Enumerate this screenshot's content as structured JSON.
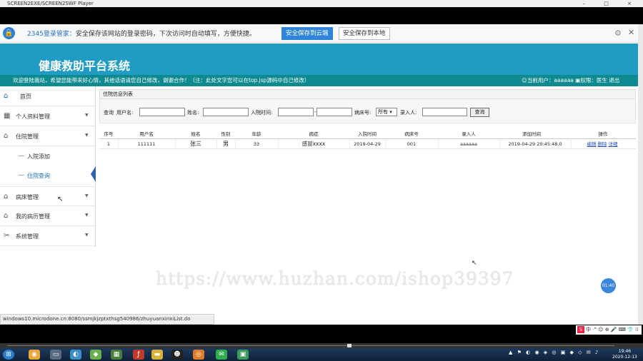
{
  "window": {
    "title": "SCREEN2EXE/SCREEN2SWF Player",
    "controls": "– □ ×"
  },
  "password_bar": {
    "brand": "2345登录管家：",
    "message": "安全保存该网站的登录密码，下次访问时自动填写，方便快捷。",
    "save_cloud": "安全保存到云端",
    "save_local": "安全保存到本地",
    "gear_icon": "⚙",
    "close_icon": "✕"
  },
  "header": {
    "title": "健康救助平台系统"
  },
  "welcome": {
    "text": "欢迎登陆我站，希望您能带来好心情，其他话语请您自己修改，谢谢合作！（注：此处文字您可以在top.jsp源码中自己修改）",
    "user_label": "当前用户：aaaaaa",
    "role_label": "权限：医生",
    "logout": "退出"
  },
  "sidebar": {
    "items": [
      {
        "label": "首页",
        "icon": "home-icon",
        "glyph": "⌂"
      },
      {
        "label": "个人资料管理",
        "icon": "grid-icon",
        "glyph": "▦"
      },
      {
        "label": "住院管理",
        "icon": "home-icon",
        "glyph": "⌂"
      },
      {
        "label": "病床管理",
        "icon": "home-icon",
        "glyph": "⌂"
      },
      {
        "label": "我的病历管理",
        "icon": "home-icon",
        "glyph": "⌂"
      },
      {
        "label": "系统管理",
        "icon": "tools-icon",
        "glyph": "✂"
      }
    ],
    "sub_items": [
      {
        "label": "入院添加"
      },
      {
        "label": "住院查询"
      }
    ],
    "arrow": "▼"
  },
  "content": {
    "list_title": "住院信息列表",
    "search": {
      "prefix": "查询",
      "username_label": "用户名:",
      "name_label": "姓名:",
      "admit_time_label": "入院时间:",
      "ward_label": "病床号:",
      "ward_selected": "所有 ▾",
      "recorder_label": "录入人:",
      "button": "查询"
    },
    "table": {
      "headers": [
        "序号",
        "用户名",
        "姓名",
        "性别",
        "年龄",
        "病症",
        "入院时间",
        "病床号",
        "录入人",
        "添加时间",
        "操作"
      ],
      "rows": [
        {
          "cells": [
            "1",
            "111111",
            "张三",
            "男",
            "33",
            "感冒xxxx",
            "2019-04-29",
            "001",
            "aaaaaa",
            "2019-04-29 20:45:48.0"
          ],
          "actions": [
            "编辑",
            "删除",
            "详细"
          ]
        }
      ]
    }
  },
  "watermark": "https://www.huzhan.com/ishop39397",
  "badge": "01:40",
  "status_url": "windows10.microdone.cn:8080/ssmjkjzptxthsg540986/zhuyuanxinxiList.do",
  "ime": {
    "logo": "S",
    "text": "中 ·° ☺ ⊕ 🎤 ⌨ 👕 ⁞⁞"
  },
  "taskbar": {
    "tray": "▲ ⚑ ◐ ◉ ◈ ◎ ▣ ◆ ◇ ✉ ♪",
    "time": "19:46",
    "date": "2020-12-13"
  }
}
